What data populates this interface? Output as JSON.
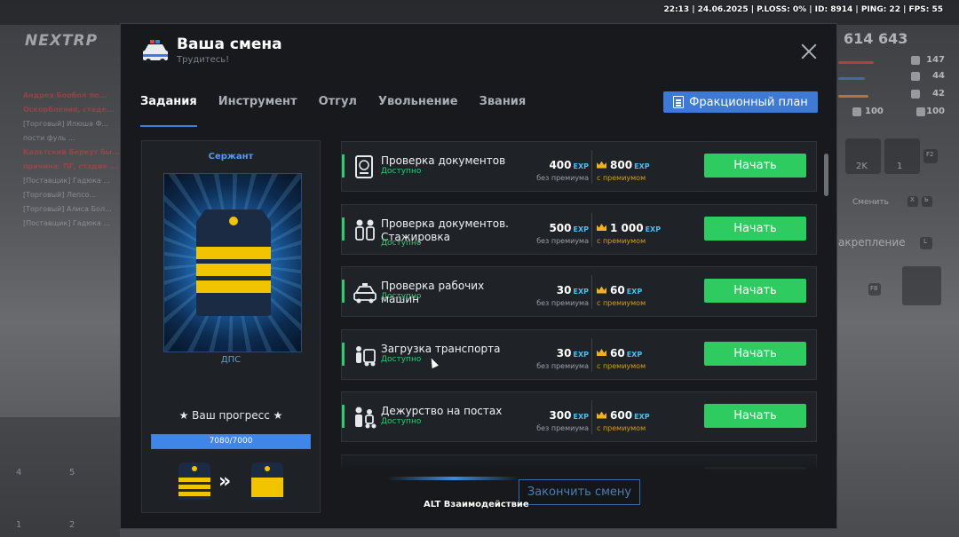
{
  "hud": {
    "status_line": "22:13 | 24.06.2025 | P.LOSS: 0% | ID: 8914 | PING: 22 | FPS: 55",
    "logo": "NEXTRP",
    "money": "614 643",
    "stats": [
      {
        "value": "147",
        "color": "#d94040"
      },
      {
        "value": "44",
        "color": "#3a7ad0"
      },
      {
        "value": "42",
        "color": "#e08a30"
      },
      {
        "value": "100",
        "color": "#6a7078"
      },
      {
        "value": "100",
        "color": "#6a7078"
      }
    ],
    "inventory": {
      "cash1": "2K",
      "cash2": "1",
      "key": "F2"
    },
    "hints": {
      "switch": "Сменить",
      "switch_key1": "X",
      "switch_key2": "Ь",
      "attach": "акрепление",
      "attach_key": "L",
      "f8": "F8"
    },
    "chat": [
      {
        "text": "Андреа Бообол по...",
        "style": "red"
      },
      {
        "text": "Оскорбления, стаде...",
        "style": "red"
      },
      {
        "text": "[Торговый] Илюша Ф...",
        "style": "gray"
      },
      {
        "text": "пости фуль ...",
        "style": "gray"
      },
      {
        "text": "Кальтский Беркут бы...",
        "style": "red"
      },
      {
        "text": "причина: ПГ, стадия ...",
        "style": "red"
      },
      {
        "text": "[Поставщик] Гадюка ...",
        "style": "gray"
      },
      {
        "text": "[Торговый] Лепсо...",
        "style": "gray"
      },
      {
        "text": "[Торговый] Алиса Бол...",
        "style": "gray"
      },
      {
        "text": "[Поставщик] Гадюка ...",
        "style": "gray"
      }
    ],
    "slots": [
      "4",
      "5",
      "1",
      "2"
    ]
  },
  "modal": {
    "title": "Ваша смена",
    "subtitle": "Трудитесь!",
    "tabs": [
      {
        "label": "Задания",
        "active": true
      },
      {
        "label": "Инструмент",
        "active": false
      },
      {
        "label": "Отгул",
        "active": false
      },
      {
        "label": "Увольнение",
        "active": false
      },
      {
        "label": "Звания",
        "active": false
      }
    ],
    "plan_button": "Фракционный план",
    "rank": {
      "name": "Сержант",
      "unit": "ДПС",
      "progress_title": "★ Ваш прогресс ★",
      "progress_text": "7080/7000",
      "progress_fraction": 1.0
    },
    "tasks": [
      {
        "name": "Проверка документов",
        "status": "Доступно",
        "base": "400",
        "prem": "800",
        "icon": "passport-icon"
      },
      {
        "name": "Проверка документов. Стажировка",
        "status": "Доступно",
        "base": "500",
        "prem": "1 000",
        "icon": "officers-icon"
      },
      {
        "name": "Проверка рабочих машин",
        "status": "Доступно",
        "base": "30",
        "prem": "60",
        "icon": "police-car-icon"
      },
      {
        "name": "Загрузка транспорта",
        "status": "Доступно",
        "base": "30",
        "prem": "60",
        "icon": "loading-icon"
      },
      {
        "name": "Дежурство на постах",
        "status": "Доступно",
        "base": "300",
        "prem": "600",
        "icon": "patrol-icon"
      }
    ],
    "exp_label": "EXP",
    "base_label": "без премиума",
    "prem_label": "с премиумом",
    "start_label": "Начать",
    "end_shift": "Закончить смену"
  },
  "interaction_hint": "ALT Взаимодействие"
}
